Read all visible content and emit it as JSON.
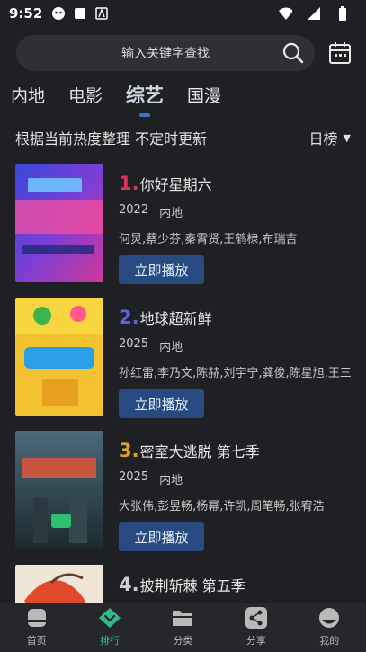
{
  "status": {
    "time": "9:52"
  },
  "search": {
    "placeholder": "输入关键字查找"
  },
  "tabs": [
    {
      "label": "内地"
    },
    {
      "label": "电影"
    },
    {
      "label": "综艺"
    },
    {
      "label": "国漫"
    }
  ],
  "subhead": {
    "text": "根据当前热度整理 不定时更新",
    "ranking": "日榜"
  },
  "items": [
    {
      "rank": "1.",
      "title": "你好星期六",
      "year": "2022",
      "region": "内地",
      "cast": "何炅,蔡少芬,秦霄贤,王鹤棣,布瑞吉",
      "play": "立即播放",
      "rank_color": "#d9355a"
    },
    {
      "rank": "2.",
      "title": "地球超新鲜",
      "year": "2025",
      "region": "内地",
      "cast": "孙红雷,李乃文,陈赫,刘宇宁,龚俊,陈星旭,王三",
      "play": "立即播放",
      "rank_color": "#5b63e0"
    },
    {
      "rank": "3.",
      "title": "密室大逃脱 第七季",
      "year": "2025",
      "region": "内地",
      "cast": "大张伟,彭昱畅,杨幂,许凯,周笔畅,张宥浩",
      "play": "立即播放",
      "rank_color": "#e0a12c"
    },
    {
      "rank": "4.",
      "title": "披荆斩棘 第五季",
      "rank_color": "#cfcfcf"
    }
  ],
  "nav": [
    {
      "label": "首页"
    },
    {
      "label": "排行"
    },
    {
      "label": "分类"
    },
    {
      "label": "分享"
    },
    {
      "label": "我的"
    }
  ]
}
